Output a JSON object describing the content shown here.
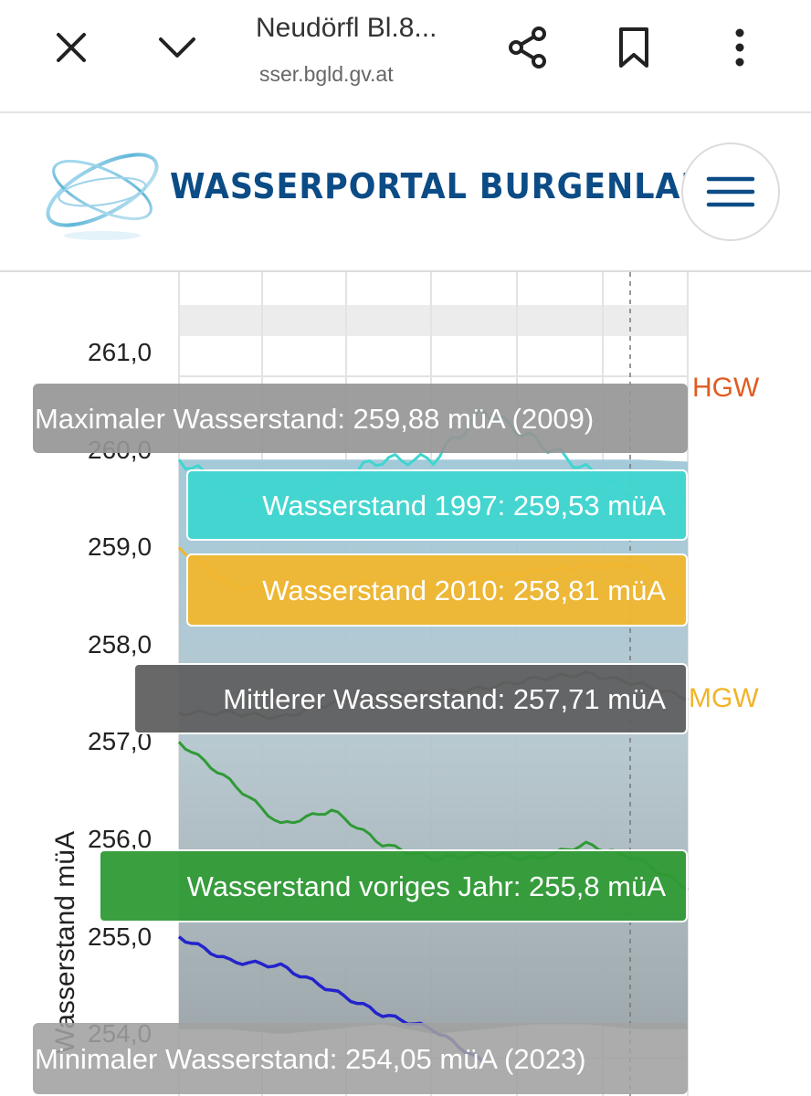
{
  "browser": {
    "page_title": "Neudörfl Bl.8...",
    "host": "sser.bgld.gv.at",
    "icons": [
      "close-icon",
      "chevron-down-icon",
      "share-icon",
      "bookmark-icon",
      "more-vert-icon"
    ]
  },
  "site": {
    "brand": "WASSERPORTAL BURGENLAND",
    "brand_color": "#0c4c86",
    "menu_icon": "hamburger-menu-icon"
  },
  "chart": {
    "y_axis_title": "Wasserstand müA",
    "y_ticks": [
      "261,0",
      "260,0",
      "259,0",
      "258,0",
      "257,0",
      "256,0",
      "255,0",
      "254,0"
    ],
    "reference_labels": {
      "hgw": "HGW",
      "mgw": "MGW"
    },
    "colors": {
      "hgw": "#e15b20",
      "mgw": "#f0b429",
      "series_1997": "#3fd6cf",
      "series_2010": "#f0b62e",
      "series_mean": "#555555",
      "series_prev_year": "#2f9a35",
      "series_current": "#2323cc"
    }
  },
  "tooltips": {
    "max": "Maximaler Wasserstand: 259,88 müA (2009)",
    "y1997": "Wasserstand 1997: 259,53 müA",
    "y2010": "Wasserstand 2010: 258,81 müA",
    "mean": "Mittlerer Wasserstand: 257,71 müA",
    "prev_year": "Wasserstand voriges Jahr: 255,8 müA",
    "min": "Minimaler Wasserstand: 254,05 müA (2023)"
  },
  "chart_data": {
    "type": "line",
    "title": "",
    "xlabel": "",
    "ylabel": "Wasserstand müA",
    "ylim": [
      253.9,
      261.4
    ],
    "y_ticks": [
      261,
      260,
      259,
      258,
      257,
      256,
      255,
      254
    ],
    "x": [
      0,
      0.1,
      0.2,
      0.3,
      0.4,
      0.5,
      0.6,
      0.7,
      0.8,
      0.9,
      1.0
    ],
    "series": [
      {
        "name": "Maximaler Wasserstand",
        "values": [
          259.9,
          259.9,
          259.9,
          259.9,
          259.9,
          259.9,
          259.9,
          259.9,
          259.9,
          259.9,
          259.88
        ]
      },
      {
        "name": "Wasserstand 1997",
        "values": [
          259.9,
          259.6,
          259.3,
          259.7,
          259.9,
          259.9,
          260.4,
          260.1,
          259.8,
          259.5,
          259.5
        ]
      },
      {
        "name": "Wasserstand 2010",
        "values": [
          259.0,
          258.6,
          258.55,
          258.6,
          258.65,
          258.6,
          258.7,
          258.75,
          258.8,
          258.81,
          258.5
        ]
      },
      {
        "name": "Mittlerer Wasserstand",
        "values": [
          257.3,
          257.3,
          257.25,
          257.4,
          257.5,
          257.5,
          257.55,
          257.65,
          257.7,
          257.6,
          257.45
        ]
      },
      {
        "name": "Wasserstand voriges Jahr",
        "values": [
          257.0,
          256.6,
          256.15,
          256.3,
          255.95,
          255.8,
          255.85,
          255.8,
          255.95,
          255.8,
          255.5
        ]
      },
      {
        "name": "Wasserstand",
        "values": [
          255.0,
          254.75,
          254.7,
          254.45,
          254.2,
          254.05,
          253.7
        ]
      },
      {
        "name": "Minimaler Wasserstand",
        "values": [
          254.05,
          254.05,
          254.0,
          254.05,
          254.1,
          254.0,
          254.05,
          254.1,
          254.1,
          254.05,
          254.05
        ]
      }
    ]
  }
}
